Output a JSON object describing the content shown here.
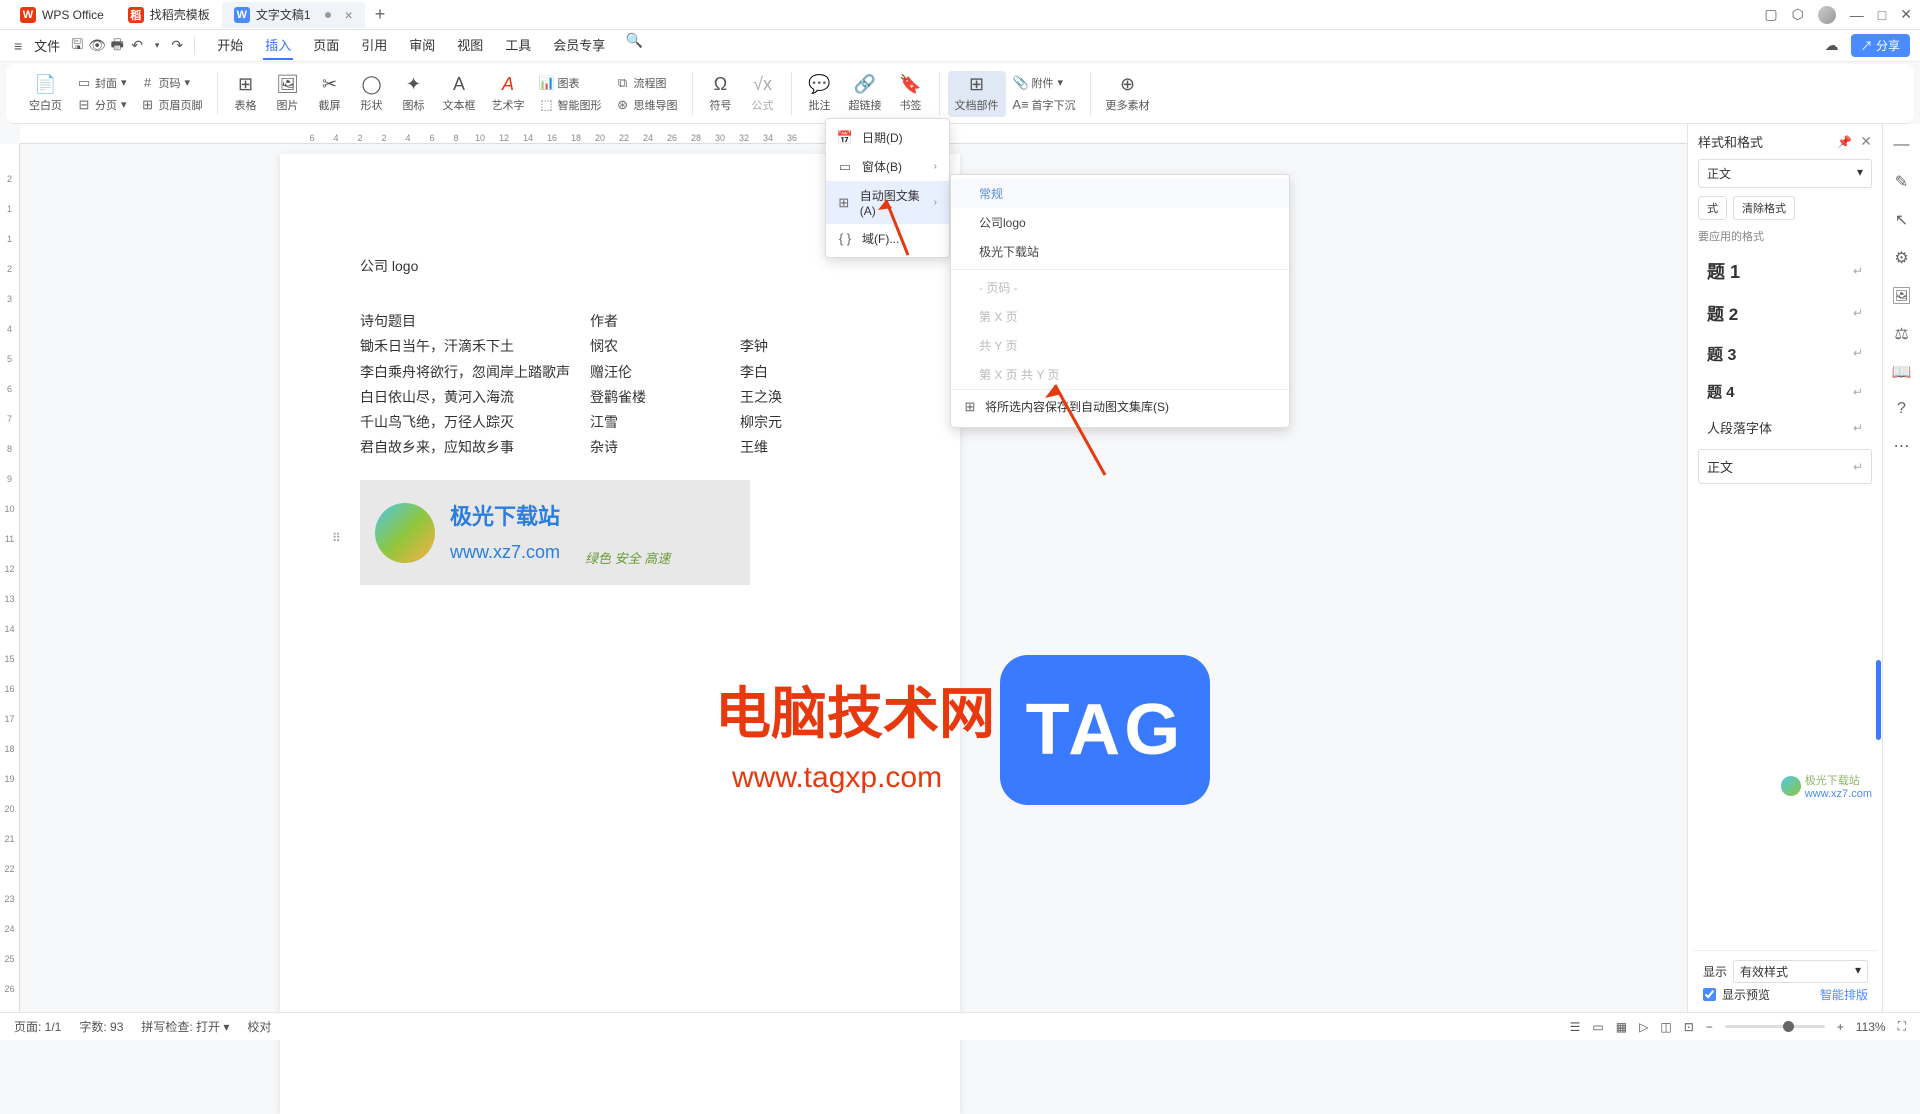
{
  "titlebar": {
    "app": "WPS Office",
    "tabs": [
      {
        "icon_bg": "#e8380d",
        "icon_text": "稻",
        "label": "找稻壳模板"
      },
      {
        "icon_bg": "#4a8cff",
        "icon_text": "W",
        "label": "文字文稿1",
        "active": true
      }
    ]
  },
  "menubar": {
    "file": "文件",
    "tabs": [
      "开始",
      "插入",
      "页面",
      "引用",
      "审阅",
      "视图",
      "工具",
      "会员专享"
    ],
    "active": "插入",
    "share": "分享"
  },
  "ribbon": {
    "blank": "空白页",
    "cover": "封面",
    "pageno": "页码",
    "pagebreak": "分页",
    "headerfooter": "页眉页脚",
    "table": "表格",
    "image": "图片",
    "screenshot": "截屏",
    "shape": "形状",
    "icon": "图标",
    "textbox": "文本框",
    "wordart": "艺术字",
    "chart": "图表",
    "flowchart": "流程图",
    "smartart": "智能图形",
    "mindmap": "思维导图",
    "symbol": "符号",
    "equation": "公式",
    "comment": "批注",
    "hyperlink": "超链接",
    "bookmark": "书签",
    "docparts": "文档部件",
    "attachment": "附件",
    "dropcap": "首字下沉",
    "more": "更多素材"
  },
  "h_ruler": [
    "6",
    "4",
    "2",
    "2",
    "4",
    "6",
    "8",
    "10",
    "12",
    "14",
    "16",
    "18",
    "20",
    "22",
    "24",
    "26",
    "28",
    "30",
    "32",
    "34",
    "36"
  ],
  "v_ruler": [
    "2",
    "1",
    "1",
    "2",
    "3",
    "4",
    "5",
    "6",
    "7",
    "8",
    "9",
    "10",
    "11",
    "12",
    "13",
    "14",
    "15",
    "16",
    "17",
    "18",
    "19",
    "20",
    "21",
    "22",
    "23",
    "24",
    "25",
    "26"
  ],
  "doc": {
    "header": "公司 logo",
    "rows": [
      [
        "诗句题目",
        "作者",
        ""
      ],
      [
        "锄禾日当午，汗滴禾下土",
        "悯农",
        "李钟"
      ],
      [
        "李白乘舟将欲行，忽闻岸上踏歌声",
        "赠汪伦",
        "李白"
      ],
      [
        "白日依山尽，黄河入海流",
        "登鹳雀楼",
        "王之涣"
      ],
      [
        "千山鸟飞绝，万径人踪灭",
        "江雪",
        "柳宗元"
      ],
      [
        "君自故乡来，应知故乡事",
        "杂诗",
        "王维"
      ]
    ],
    "logo_title": "极光下载站",
    "logo_url": "www.xz7.com",
    "logo_slogan": "绿色 安全 高速"
  },
  "dropdown1": [
    {
      "icon": "📅",
      "label": "日期(D)"
    },
    {
      "icon": "▭",
      "label": "窗体(B)",
      "arrow": true
    },
    {
      "icon": "⊞",
      "label": "自动图文集(A)",
      "arrow": true,
      "hl": true
    },
    {
      "icon": "{ }",
      "label": "域(F)..."
    }
  ],
  "dropdown2": {
    "header": "常规",
    "items": [
      "公司logo",
      "极光下载站"
    ],
    "disabled": [
      "- 页码 -",
      "第 X 页",
      "共 Y 页",
      "第 X 页 共 Y 页"
    ],
    "save": "将所选内容保存到自动图文集库(S)"
  },
  "styles_panel": {
    "title": "样式和格式",
    "current": "正文",
    "new_btn": "式",
    "clear_btn": "清除格式",
    "note": "要应用的格式",
    "items": [
      "题 1",
      "题 2",
      "题 3",
      "题 4",
      "人段落字体",
      "正文"
    ],
    "display_label": "显示",
    "display_value": "有效样式",
    "preview": "显示预览",
    "smart": "智能排版"
  },
  "status": {
    "page": "页面: 1/1",
    "words": "字数: 93",
    "spell": "拼写检查: 打开",
    "proof": "校对",
    "zoom": "113%"
  },
  "overlay": {
    "brand": "电脑技术网",
    "url": "www.tagxp.com",
    "badge": "TAG",
    "wm": "极光下载站",
    "wm_url": "www.xz7.com"
  }
}
